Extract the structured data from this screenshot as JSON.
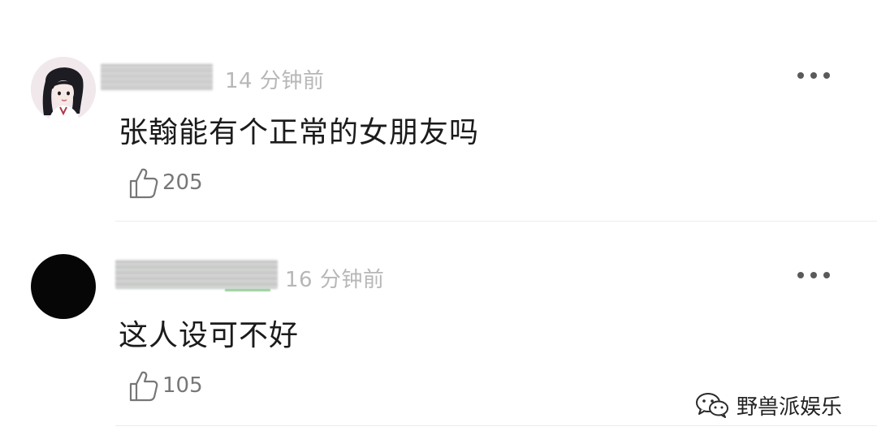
{
  "comments": [
    {
      "time": "14 分钟前",
      "text": "张翰能有个正常的女朋友吗",
      "likes": "205"
    },
    {
      "time": "16 分钟前",
      "text": "这人设可不好",
      "likes": "105"
    }
  ],
  "icons": {
    "more": "more-dots-icon",
    "like": "thumbs-up-icon",
    "wechat": "wechat-icon"
  },
  "watermark": {
    "label": "野兽派娱乐"
  },
  "colors": {
    "time_text": "#b7b7b7",
    "comment_text": "#1b1b1b",
    "like_text": "#777777",
    "divider": "#ececec"
  }
}
